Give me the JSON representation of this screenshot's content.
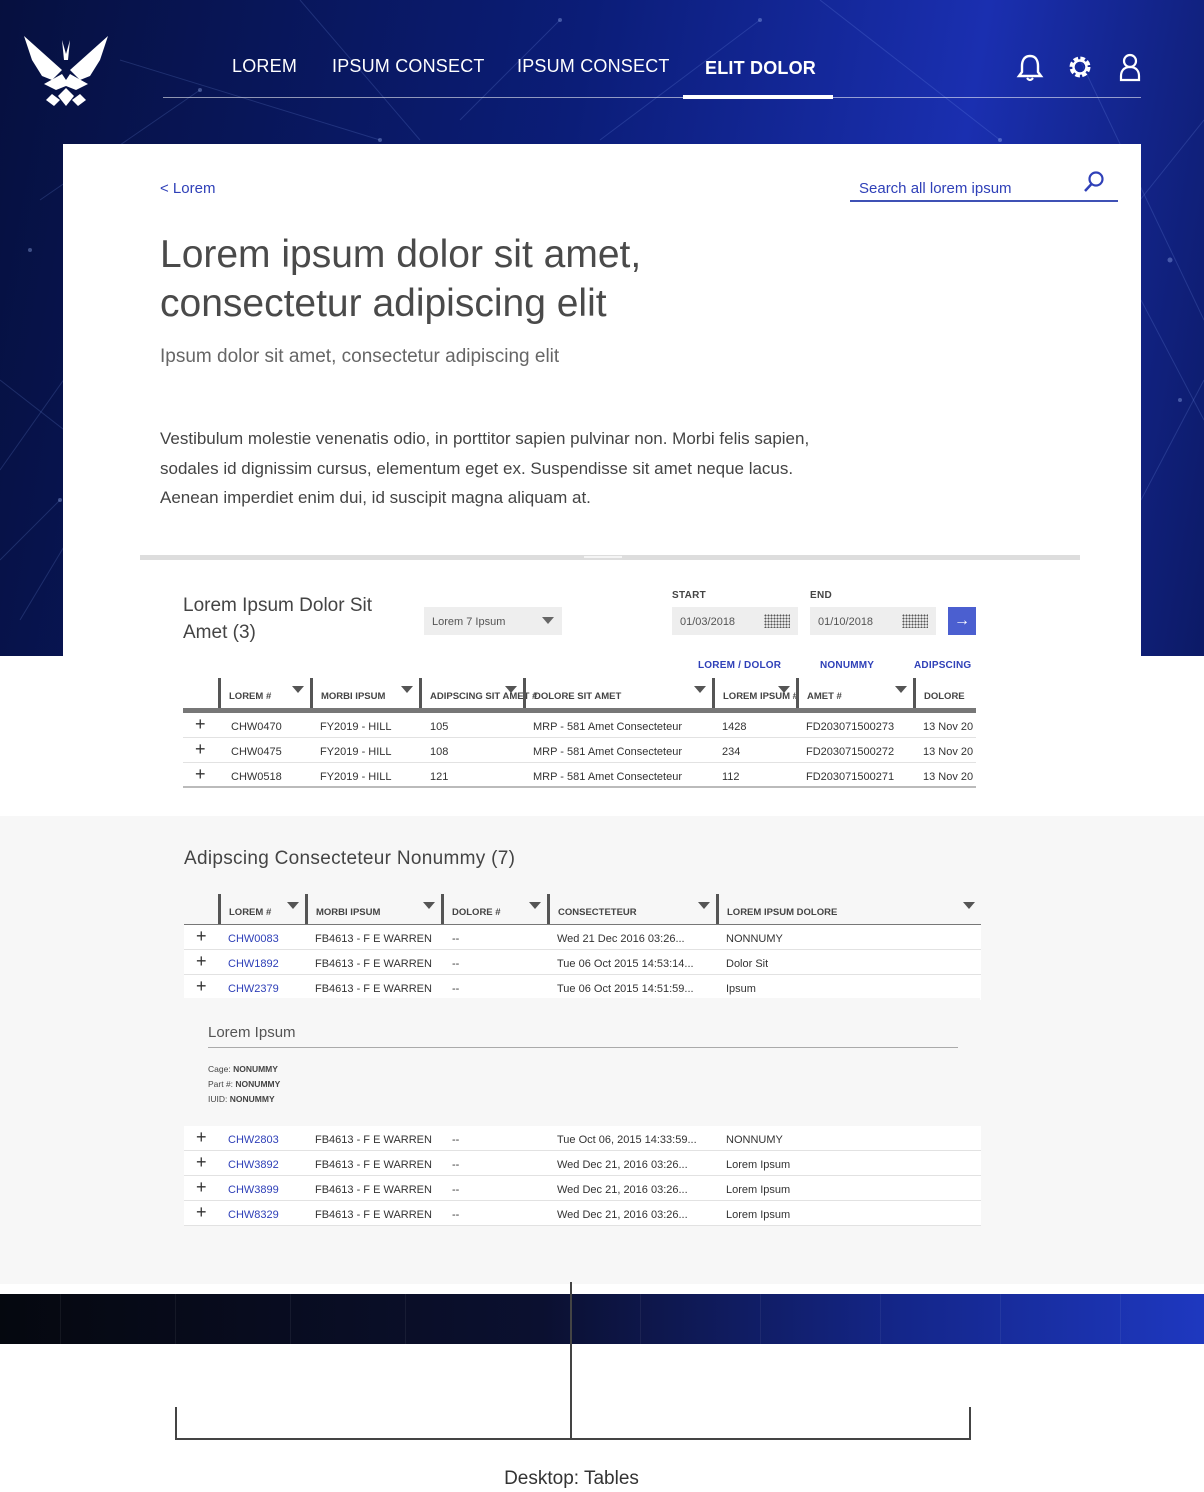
{
  "nav": {
    "items": [
      "LOREM",
      "IPSUM CONSECT",
      "IPSUM CONSECT",
      "ELIT DOLOR"
    ],
    "active_index": 3
  },
  "icons": {
    "logo": "air-force-wings-logo",
    "bell": "bell-icon",
    "settings": "gear-icon",
    "user": "user-icon",
    "search": "search-icon"
  },
  "header": {
    "back_label": "< Lorem",
    "search_placeholder": "Search all lorem ipsum",
    "title": "Lorem ipsum dolor sit amet, consectetur adipiscing elit",
    "subtitle": "Ipsum dolor sit amet, consectetur adipiscing elit",
    "body": "Vestibulum molestie venenatis odio, in porttitor sapien pulvinar non. Morbi felis sapien, sodales id dignissim cursus, elementum eget ex. Suspendisse sit amet neque lacus. Aenean imperdiet enim dui, id suscipit magna aliquam at."
  },
  "table1": {
    "title": "Lorem Ipsum Dolor Sit Amet (3)",
    "dropdown_value": "Lorem 7 Ipsum",
    "start_label": "START",
    "start_value": "01/03/2018",
    "end_label": "END",
    "end_value": "01/10/2018",
    "go_label": "→",
    "column_links": [
      "LOREM / DOLOR",
      "NONUMMY",
      "ADIPSCING"
    ],
    "columns": [
      "LOREM #",
      "MORBI IPSUM",
      "ADIPSCING SIT AMET #",
      "DOLORE SIT AMET",
      "LOREM IPSUM #",
      "AMET #",
      "DOLORE"
    ],
    "rows": [
      [
        "CHW0470",
        "FY2019 - HILL",
        "105",
        "MRP - 581 Amet Consecteteur",
        "1428",
        "FD203071500273",
        "13 Nov 20"
      ],
      [
        "CHW0475",
        "FY2019 - HILL",
        "108",
        "MRP - 581 Amet Consecteteur",
        "234",
        "FD203071500272",
        "13 Nov 20"
      ],
      [
        "CHW0518",
        "FY2019 - HILL",
        "121",
        "MRP - 581 Amet Consecteteur",
        "112",
        "FD203071500271",
        "13 Nov 20"
      ]
    ]
  },
  "table2": {
    "title": "Adipscing Consecteteur Nonummy (7)",
    "columns": [
      "LOREM #",
      "MORBI IPSUM",
      "DOLORE #",
      "CONSECTETEUR",
      "LOREM IPSUM DOLORE"
    ],
    "rows": [
      [
        "CHW0083",
        "FB4613 - F E WARREN",
        "--",
        "Wed 21 Dec 2016 03:26...",
        "NONNUMY"
      ],
      [
        "CHW1892",
        "FB4613 - F E WARREN",
        "--",
        "Tue 06 Oct 2015 14:53:14...",
        "Dolor Sit"
      ],
      [
        "CHW2379",
        "FB4613 - F E WARREN",
        "--",
        "Tue 06 Oct 2015 14:51:59...",
        "Ipsum"
      ]
    ],
    "detail": {
      "title": "Lorem Ipsum",
      "cage_label": "Cage:",
      "cage_value": "NONUMMY",
      "part_label": "Part #:",
      "part_value": "NONUMMY",
      "iuid_label": "IUID:",
      "iuid_value": "NONUMMY"
    },
    "rows_after": [
      [
        "CHW2803",
        "FB4613 - F E WARREN",
        "--",
        "Tue Oct 06, 2015 14:33:59...",
        "NONNUMY"
      ],
      [
        "CHW3892",
        "FB4613 - F E WARREN",
        "--",
        "Wed Dec 21, 2016 03:26...",
        "Lorem Ipsum"
      ],
      [
        "CHW3899",
        "FB4613 - F E WARREN",
        "--",
        "Wed Dec 21, 2016 03:26...",
        "Lorem Ipsum"
      ],
      [
        "CHW8329",
        "FB4613 - F E WARREN",
        "--",
        "Wed Dec 21, 2016 03:26...",
        "Lorem Ipsum"
      ]
    ]
  },
  "caption": "Desktop: Tables",
  "colors": {
    "brand_blue": "#2f40b8",
    "button_blue": "#4b5fd0",
    "header_dark": "#06103f"
  }
}
